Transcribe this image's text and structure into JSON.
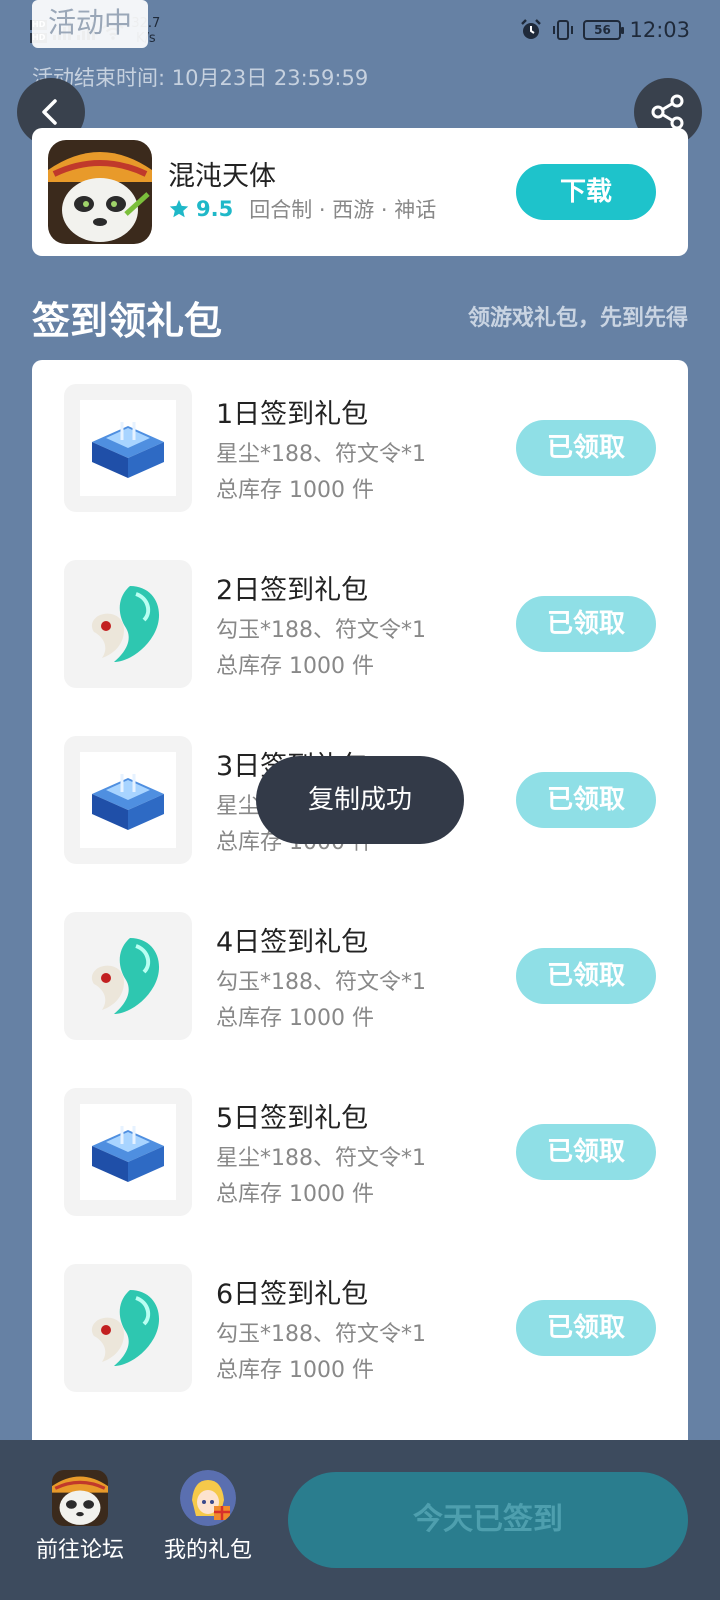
{
  "status_bar": {
    "hd1": "HD",
    "hd2": "HD",
    "net_speed_value": "32.7",
    "net_speed_unit": "K/s",
    "battery": "56",
    "time": "12:03",
    "activity_chip": "活动中"
  },
  "header": {
    "end_time": "活动结束时间: 10月23日 23:59:59"
  },
  "game": {
    "name": "混沌天体",
    "rating": "9.5",
    "tags": "回合制 · 西游 · 神话",
    "download_label": "下载"
  },
  "section": {
    "title": "签到领礼包",
    "subtitle": "领游戏礼包，先到先得"
  },
  "gifts": [
    {
      "title": "1日签到礼包",
      "items": "星尘*188、符文令*1",
      "stock": "总库存 1000 件",
      "button": "已领取",
      "icon": "blue-chest-icon"
    },
    {
      "title": "2日签到礼包",
      "items": "勾玉*188、符文令*1",
      "stock": "总库存 1000 件",
      "button": "已领取",
      "icon": "jade-magatama-icon"
    },
    {
      "title": "3日签到礼包",
      "items": "星尘*188、符文令*1",
      "stock": "总库存 1000 件",
      "button": "已领取",
      "icon": "blue-chest-icon"
    },
    {
      "title": "4日签到礼包",
      "items": "勾玉*188、符文令*1",
      "stock": "总库存 1000 件",
      "button": "已领取",
      "icon": "jade-magatama-icon"
    },
    {
      "title": "5日签到礼包",
      "items": "星尘*188、符文令*1",
      "stock": "总库存 1000 件",
      "button": "已领取",
      "icon": "blue-chest-icon"
    },
    {
      "title": "6日签到礼包",
      "items": "勾玉*188、符文令*1",
      "stock": "总库存 1000 件",
      "button": "已领取",
      "icon": "jade-magatama-icon"
    }
  ],
  "toast": "复制成功",
  "bottom_bar": {
    "forum_label": "前往论坛",
    "my_gifts_label": "我的礼包",
    "signed_label": "今天已签到"
  },
  "colors": {
    "background": "#6681a4",
    "accent": "#1ec3cb",
    "claimed": "#8fdfe6",
    "bottom_bar": "#3d4b5e"
  }
}
